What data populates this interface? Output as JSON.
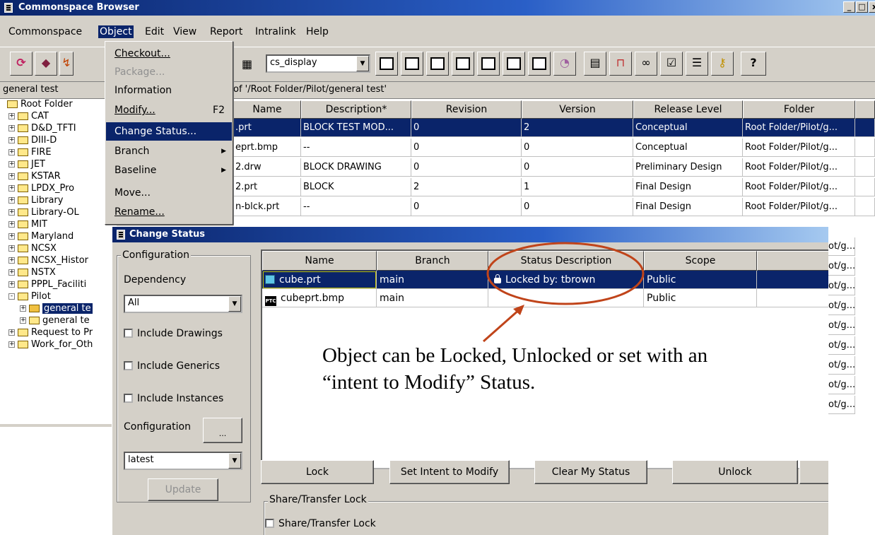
{
  "main_window": {
    "title": "Commonspace Browser",
    "title_buttons": [
      "_",
      "□",
      "x"
    ],
    "menu": [
      "Commonspace",
      "Object",
      "Edit",
      "View",
      "Report",
      "Intralink",
      "Help"
    ],
    "config_combo": "cs_display",
    "folder_header": "general test",
    "path_text": "of '/Root Folder/Pilot/general test'",
    "tree": [
      {
        "label": "Root Folder",
        "expander": "",
        "indent": 0
      },
      {
        "label": "CAT",
        "expander": "+",
        "indent": 1
      },
      {
        "label": "D&D_TFTI",
        "expander": "+",
        "indent": 1
      },
      {
        "label": "DIII-D",
        "expander": "+",
        "indent": 1
      },
      {
        "label": "FIRE",
        "expander": "+",
        "indent": 1
      },
      {
        "label": "JET",
        "expander": "+",
        "indent": 1
      },
      {
        "label": "KSTAR",
        "expander": "+",
        "indent": 1
      },
      {
        "label": "LPDX_Pro",
        "expander": "+",
        "indent": 1
      },
      {
        "label": "Library",
        "expander": "+",
        "indent": 1
      },
      {
        "label": "Library-OL",
        "expander": "+",
        "indent": 1
      },
      {
        "label": "MIT",
        "expander": "+",
        "indent": 1
      },
      {
        "label": "Maryland",
        "expander": "+",
        "indent": 1
      },
      {
        "label": "NCSX",
        "expander": "+",
        "indent": 1
      },
      {
        "label": "NCSX_Histor",
        "expander": "+",
        "indent": 1
      },
      {
        "label": "NSTX",
        "expander": "+",
        "indent": 1
      },
      {
        "label": "PPPL_Faciliti",
        "expander": "+",
        "indent": 1
      },
      {
        "label": "Pilot",
        "expander": "-",
        "indent": 1
      },
      {
        "label": "general te",
        "expander": "+",
        "indent": 2
      },
      {
        "label": "general te",
        "expander": "+",
        "indent": 2
      },
      {
        "label": "Request to Pr",
        "expander": "+",
        "indent": 1
      },
      {
        "label": "Work_for_Oth",
        "expander": "+",
        "indent": 1
      }
    ],
    "table": {
      "columns": [
        "Name",
        "Description*",
        "Revision",
        "Version",
        "Release Level",
        "Folder"
      ],
      "rows": [
        [
          ".prt",
          "BLOCK TEST MOD...",
          "0",
          "2",
          "Conceptual",
          "Root Folder/Pilot/g..."
        ],
        [
          "eprt.bmp",
          "--",
          "0",
          "0",
          "Conceptual",
          "Root Folder/Pilot/g..."
        ],
        [
          "2.drw",
          "BLOCK DRAWING",
          "0",
          "0",
          "Preliminary Design",
          "Root Folder/Pilot/g..."
        ],
        [
          "2.prt",
          "BLOCK",
          "2",
          "1",
          "Final Design",
          "Root Folder/Pilot/g..."
        ],
        [
          "n-blck.prt",
          "--",
          "0",
          "0",
          "Final Design",
          "Root Folder/Pilot/g..."
        ]
      ],
      "folder_stubs": [
        "Root Folder/Pilot/g...",
        "ot/g...",
        "ot/g...",
        "ot/g...",
        "ot/g...",
        "ot/g...",
        "ot/g...",
        "ot/g...",
        "ot/g...",
        "ot/g..."
      ]
    }
  },
  "object_menu": {
    "items": [
      {
        "label": "Checkout...",
        "accel": "",
        "state": "normal",
        "submenu": false
      },
      {
        "label": "Package...",
        "accel": "",
        "state": "disabled",
        "submenu": false
      },
      {
        "label": "Information",
        "accel": "",
        "state": "normal",
        "submenu": false
      },
      {
        "label": "Modify...",
        "accel": "F2",
        "state": "normal",
        "submenu": false
      },
      {
        "label": "Change Status...",
        "accel": "",
        "state": "highlighted",
        "submenu": false
      },
      {
        "label": "Branch",
        "accel": "",
        "state": "normal",
        "submenu": true
      },
      {
        "label": "Baseline",
        "accel": "",
        "state": "normal",
        "submenu": true
      },
      {
        "label": "Move...",
        "accel": "",
        "state": "normal",
        "submenu": false
      },
      {
        "label": "Rename...",
        "accel": "",
        "state": "normal",
        "submenu": false
      }
    ]
  },
  "change_status_dialog": {
    "title": "Change Status",
    "configuration_group": "Configuration",
    "dependency_label": "Dependency",
    "dependency_value": "All",
    "include_drawings": "Include Drawings",
    "include_generics": "Include Generics",
    "include_instances": "Include Instances",
    "configuration_label": "Configuration",
    "ellipsis_button": "...",
    "configuration_value": "latest",
    "update_button": "Update",
    "columns": [
      "Name",
      "Branch",
      "Status Description",
      "Scope"
    ],
    "rows": [
      {
        "name": "cube.prt",
        "icon": "cube-part-icon",
        "branch": "main",
        "status": "Locked by: tbrown",
        "scope": "Public",
        "selected": true
      },
      {
        "name": "cubeprt.bmp",
        "icon": "ptc-image-icon",
        "branch": "main",
        "status": "",
        "scope": "Public",
        "selected": false
      }
    ],
    "buttons": [
      "Lock",
      "Set Intent to Modify",
      "Clear My Status",
      "Unlock"
    ],
    "share_group": "Share/Transfer Lock",
    "share_checkbox": "Share/Transfer Lock"
  },
  "annotation": {
    "text": "Object can be Locked, Unlocked or set with an “intent to Modify” Status.",
    "ellipse_color": "#c0441a",
    "arrow_color": "#c0441a"
  },
  "colors": {
    "selection": "#0a246a",
    "window_face": "#d4d0c8",
    "title_gradient_start": "#0a246a",
    "title_gradient_end": "#a6caf0"
  },
  "icons": [
    "refresh-icon",
    "tag-icon",
    "grid-icon",
    "checkout-icon",
    "folder-icon",
    "binoculars-icon",
    "key-icon",
    "help-icon",
    "lock-icon"
  ]
}
